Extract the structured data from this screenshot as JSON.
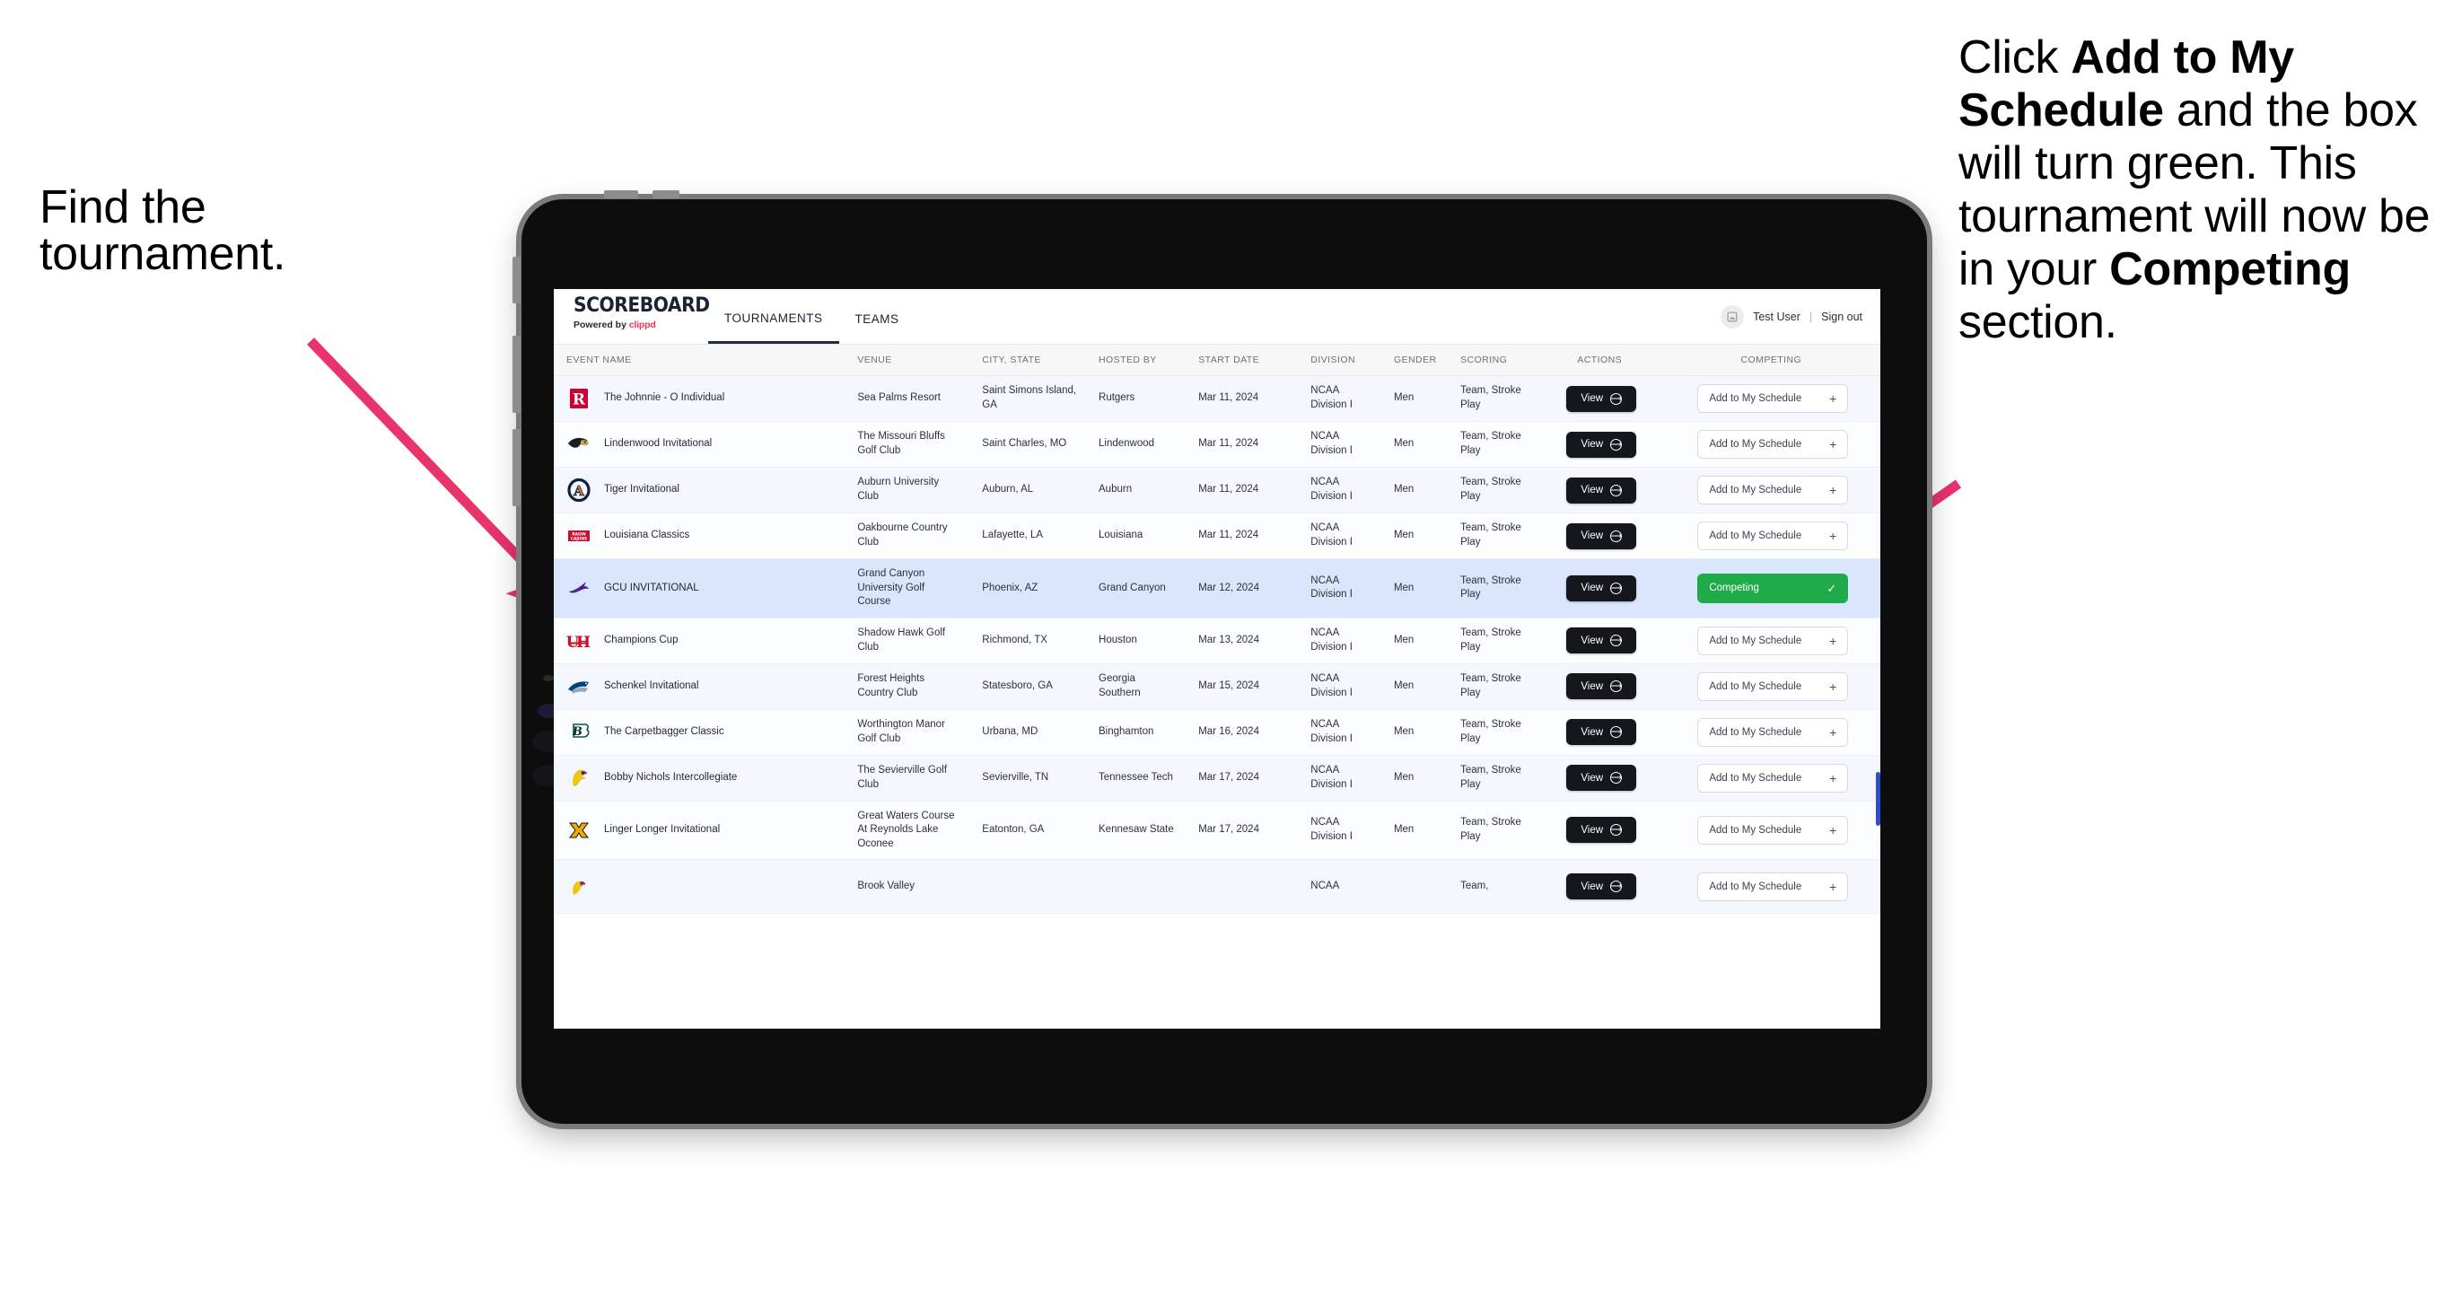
{
  "annotations": {
    "left": "Find the tournament.",
    "right_parts": [
      {
        "t": "Click ",
        "b": false
      },
      {
        "t": "Add to My Schedule",
        "b": true
      },
      {
        "t": " and the box will turn green. This tournament will now be in your ",
        "b": false
      },
      {
        "t": "Competing",
        "b": true
      },
      {
        "t": " section.",
        "b": false
      }
    ],
    "arrow_color": "#e8336b"
  },
  "app": {
    "brand": {
      "title": "SCOREBOARD",
      "powered_prefix": "Powered by ",
      "powered_name": "clippd"
    },
    "nav": [
      {
        "label": "TOURNAMENTS",
        "active": true
      },
      {
        "label": "TEAMS",
        "active": false
      }
    ],
    "user": {
      "avatar_icon": "user-avatar-icon",
      "name": "Test User",
      "separator": "|",
      "signout": "Sign out"
    },
    "table": {
      "columns": [
        "EVENT NAME",
        "VENUE",
        "CITY, STATE",
        "HOSTED BY",
        "START DATE",
        "DIVISION",
        "GENDER",
        "SCORING",
        "ACTIONS",
        "COMPETING"
      ],
      "action_label": "View",
      "add_label": "Add to My Schedule",
      "add_icon": "plus-icon",
      "competing_label": "Competing",
      "competing_icon": "check-icon",
      "competing_color": "#20ab4b",
      "rows": [
        {
          "logo": "rutgers",
          "event": "The Johnnie - O Individual",
          "venue": "Sea Palms Resort",
          "city": "Saint Simons Island, GA",
          "host": "Rutgers",
          "date": "Mar 11, 2024",
          "division": "NCAA Division I",
          "gender": "Men",
          "scoring": "Team, Stroke Play",
          "competing": false
        },
        {
          "logo": "lindenwood",
          "event": "Lindenwood Invitational",
          "venue": "The Missouri Bluffs Golf Club",
          "city": "Saint Charles, MO",
          "host": "Lindenwood",
          "date": "Mar 11, 2024",
          "division": "NCAA Division I",
          "gender": "Men",
          "scoring": "Team, Stroke Play",
          "competing": false
        },
        {
          "logo": "auburn",
          "event": "Tiger Invitational",
          "venue": "Auburn University Club",
          "city": "Auburn, AL",
          "host": "Auburn",
          "date": "Mar 11, 2024",
          "division": "NCAA Division I",
          "gender": "Men",
          "scoring": "Team, Stroke Play",
          "competing": false
        },
        {
          "logo": "louisiana",
          "event": "Louisiana Classics",
          "venue": "Oakbourne Country Club",
          "city": "Lafayette, LA",
          "host": "Louisiana",
          "date": "Mar 11, 2024",
          "division": "NCAA Division I",
          "gender": "Men",
          "scoring": "Team, Stroke Play",
          "competing": false
        },
        {
          "logo": "gcu",
          "event": "GCU INVITATIONAL",
          "venue": "Grand Canyon University Golf Course",
          "city": "Phoenix, AZ",
          "host": "Grand Canyon",
          "date": "Mar 12, 2024",
          "division": "NCAA Division I",
          "gender": "Men",
          "scoring": "Team, Stroke Play",
          "competing": true
        },
        {
          "logo": "houston",
          "event": "Champions Cup",
          "venue": "Shadow Hawk Golf Club",
          "city": "Richmond, TX",
          "host": "Houston",
          "date": "Mar 13, 2024",
          "division": "NCAA Division I",
          "gender": "Men",
          "scoring": "Team, Stroke Play",
          "competing": false
        },
        {
          "logo": "georgiasouthern",
          "event": "Schenkel Invitational",
          "venue": "Forest Heights Country Club",
          "city": "Statesboro, GA",
          "host": "Georgia Southern",
          "date": "Mar 15, 2024",
          "division": "NCAA Division I",
          "gender": "Men",
          "scoring": "Team, Stroke Play",
          "competing": false
        },
        {
          "logo": "binghamton",
          "event": "The Carpetbagger Classic",
          "venue": "Worthington Manor Golf Club",
          "city": "Urbana, MD",
          "host": "Binghamton",
          "date": "Mar 16, 2024",
          "division": "NCAA Division I",
          "gender": "Men",
          "scoring": "Team, Stroke Play",
          "competing": false
        },
        {
          "logo": "tntech",
          "event": "Bobby Nichols Intercollegiate",
          "venue": "The Sevierville Golf Club",
          "city": "Sevierville, TN",
          "host": "Tennessee Tech",
          "date": "Mar 17, 2024",
          "division": "NCAA Division I",
          "gender": "Men",
          "scoring": "Team, Stroke Play",
          "competing": false
        },
        {
          "logo": "kennesaw",
          "event": "Linger Longer Invitational",
          "venue": "Great Waters Course At Reynolds Lake Oconee",
          "city": "Eatonton, GA",
          "host": "Kennesaw State",
          "date": "Mar 17, 2024",
          "division": "NCAA Division I",
          "gender": "Men",
          "scoring": "Team, Stroke Play",
          "competing": false
        },
        {
          "logo": "partial",
          "event": "",
          "venue": "Brook Valley",
          "city": "",
          "host": "",
          "date": "",
          "division": "NCAA",
          "gender": "",
          "scoring": "Team,",
          "competing": false
        }
      ]
    }
  }
}
